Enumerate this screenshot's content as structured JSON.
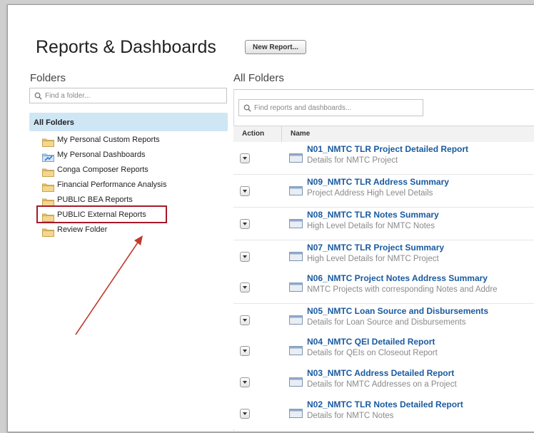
{
  "header": {
    "title": "Reports & Dashboards",
    "new_report_label": "New Report..."
  },
  "sidebar": {
    "heading": "Folders",
    "search_placeholder": "Find a folder...",
    "all_folders_label": "All Folders",
    "items": [
      {
        "label": "My Personal Custom Reports",
        "icon": "folder-icon"
      },
      {
        "label": "My Personal Dashboards",
        "icon": "dashboard-folder-icon"
      },
      {
        "label": "Conga Composer Reports",
        "icon": "folder-icon"
      },
      {
        "label": "Financial Performance Analysis",
        "icon": "folder-icon"
      },
      {
        "label": "PUBLIC BEA Reports",
        "icon": "folder-icon"
      },
      {
        "label": "PUBLIC External Reports",
        "icon": "folder-icon",
        "highlighted": true
      },
      {
        "label": "Review Folder",
        "icon": "folder-icon"
      }
    ]
  },
  "main": {
    "heading": "All Folders",
    "search_placeholder": "Find reports and dashboards...",
    "columns": [
      "Action",
      "Name"
    ],
    "rows": [
      {
        "title": "N01_NMTC TLR Project Detailed Report",
        "desc": "Details for NMTC Project"
      },
      {
        "title": "N09_NMTC TLR Address Summary",
        "desc": "Project Address High Level Details"
      },
      {
        "title": "N08_NMTC TLR Notes Summary",
        "desc": "High Level Details for NMTC Notes"
      },
      {
        "title": "N07_NMTC TLR Project Summary",
        "desc": "High Level Details for NMTC Project"
      },
      {
        "title": "N06_NMTC Project Notes Address Summary",
        "desc": "NMTC Projects with corresponding Notes and Addre"
      },
      {
        "title": "N05_NMTC Loan Source and Disbursements",
        "desc": "Details for Loan Source and Disbursements"
      },
      {
        "title": "N04_NMTC QEI Detailed Report",
        "desc": "Details for QEIs on Closeout Report"
      },
      {
        "title": "N03_NMTC Address Detailed Report",
        "desc": "Details for NMTC Addresses on a Project"
      },
      {
        "title": "N02_NMTC TLR Notes Detailed Report",
        "desc": "Details for NMTC Notes"
      }
    ]
  },
  "colors": {
    "link_blue": "#1a5aa0",
    "selected_folder_bg": "#cfe6f5",
    "highlight_red": "#a51a2a"
  }
}
